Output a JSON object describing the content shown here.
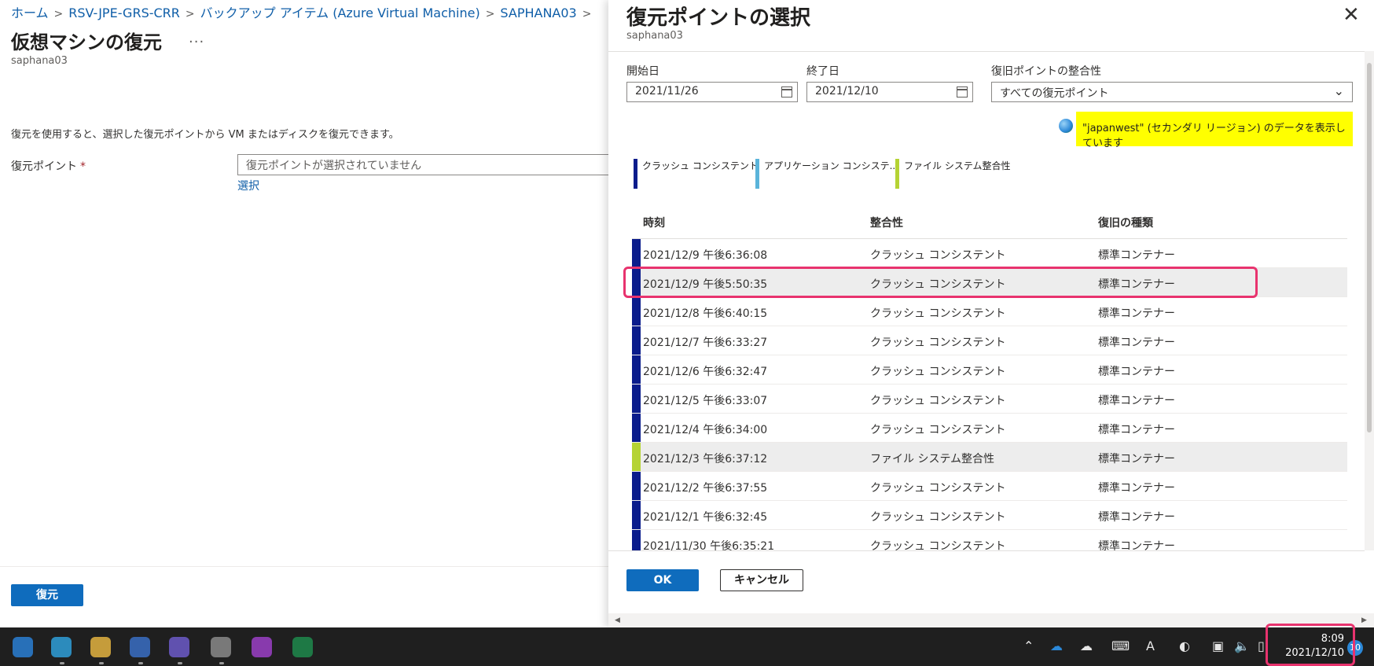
{
  "breadcrumb": {
    "items": [
      "ホーム",
      "RSV-JPE-GRS-CRR",
      "バックアップ アイテム (Azure Virtual Machine)",
      "SAPHANA03"
    ],
    "separator": ">"
  },
  "page": {
    "title": "仮想マシンの復元",
    "more_label": "...",
    "subtitle": "saphana03",
    "description": "復元を使用すると、選択した復元ポイントから VM またはディスクを復元できます。",
    "restore_point_label": "復元ポイント",
    "required_mark": "*",
    "restore_point_placeholder": "復元ポイントが選択されていません",
    "select_link": "選択",
    "restore_button": "復元"
  },
  "panel": {
    "title": "復元ポイントの選択",
    "subtitle": "saphana03",
    "close_label": "✕",
    "start_date_label": "開始日",
    "start_date_value": "2021/11/26",
    "end_date_label": "終了日",
    "end_date_value": "2021/12/10",
    "consistency_label": "復旧ポイントの整合性",
    "consistency_value": "すべての復元ポイント",
    "region_note": "\"japanwest\" (セカンダリ リージョン) のデータを表示しています",
    "legend": [
      {
        "label": "クラッシュ コンシステント",
        "color": "#0a1c8c"
      },
      {
        "label": "アプリケーション コンシステ...",
        "color": "#5ab4da"
      },
      {
        "label": "ファイル システム整合性",
        "color": "#b5d334"
      }
    ],
    "columns": [
      "時刻",
      "整合性",
      "復旧の種類"
    ],
    "rows": [
      {
        "time": "2021/12/9 午後6:36:08",
        "consistency": "クラッシュ コンシステント",
        "type": "標準コンテナー",
        "color": "#0a1c8c"
      },
      {
        "time": "2021/12/9 午後5:50:35",
        "consistency": "クラッシュ コンシステント",
        "type": "標準コンテナー",
        "color": "#0a1c8c"
      },
      {
        "time": "2021/12/8 午後6:40:15",
        "consistency": "クラッシュ コンシステント",
        "type": "標準コンテナー",
        "color": "#0a1c8c"
      },
      {
        "time": "2021/12/7 午後6:33:27",
        "consistency": "クラッシュ コンシステント",
        "type": "標準コンテナー",
        "color": "#0a1c8c"
      },
      {
        "time": "2021/12/6 午後6:32:47",
        "consistency": "クラッシュ コンシステント",
        "type": "標準コンテナー",
        "color": "#0a1c8c"
      },
      {
        "time": "2021/12/5 午後6:33:07",
        "consistency": "クラッシュ コンシステント",
        "type": "標準コンテナー",
        "color": "#0a1c8c"
      },
      {
        "time": "2021/12/4 午後6:34:00",
        "consistency": "クラッシュ コンシステント",
        "type": "標準コンテナー",
        "color": "#0a1c8c"
      },
      {
        "time": "2021/12/3 午後6:37:12",
        "consistency": "ファイル システム整合性",
        "type": "標準コンテナー",
        "color": "#b5d334"
      },
      {
        "time": "2021/12/2 午後6:37:55",
        "consistency": "クラッシュ コンシステント",
        "type": "標準コンテナー",
        "color": "#0a1c8c"
      },
      {
        "time": "2021/12/1 午後6:32:45",
        "consistency": "クラッシュ コンシステント",
        "type": "標準コンテナー",
        "color": "#0a1c8c"
      },
      {
        "time": "2021/11/30 午後6:35:21",
        "consistency": "クラッシュ コンシステント",
        "type": "標準コンテナー",
        "color": "#0a1c8c"
      }
    ],
    "selected_row_index": 1,
    "ok_button": "OK",
    "cancel_button": "キャンセル"
  },
  "taskbar": {
    "time": "8:09",
    "date": "2021/12/10",
    "notification_count": "10",
    "ime_label": "A"
  },
  "colors": {
    "accent": "#0f6cbd",
    "highlight": "#ffff00",
    "annotation": "#e8336e"
  }
}
